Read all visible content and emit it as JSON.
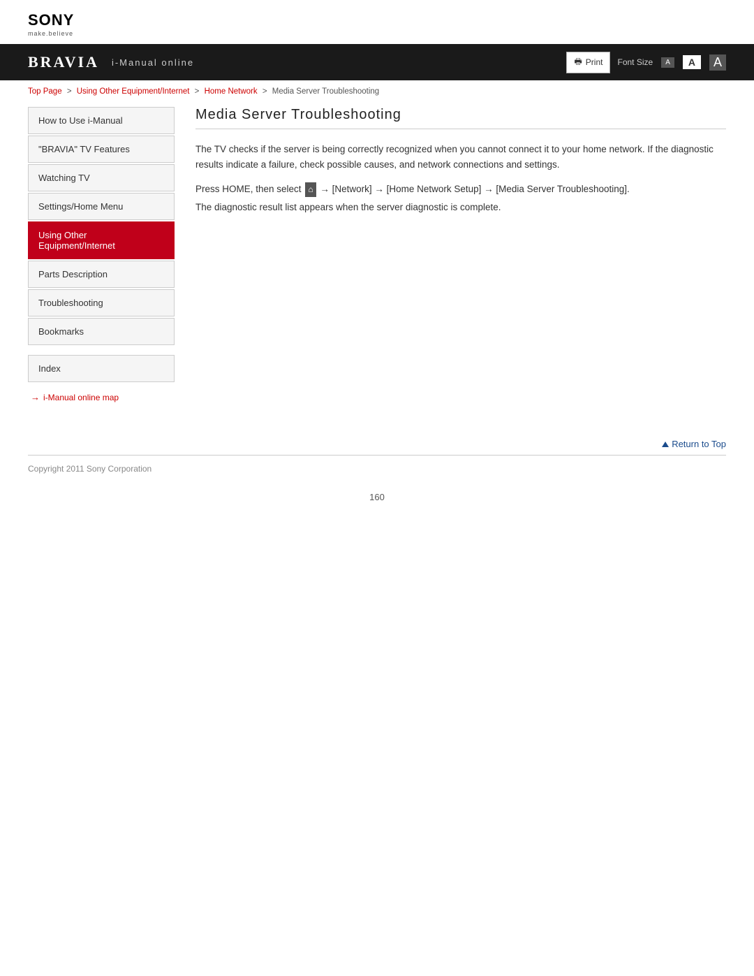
{
  "logo": {
    "brand": "SONY",
    "tagline": "make.believe"
  },
  "header": {
    "bravia": "BRAVIA",
    "imanual": "i-Manual online",
    "print_label": "Print",
    "font_size_label": "Font Size",
    "font_small": "A",
    "font_medium": "A",
    "font_large": "A"
  },
  "breadcrumb": {
    "top_page": "Top Page",
    "sep1": ">",
    "using_other": "Using Other Equipment/Internet",
    "sep2": ">",
    "home_network": "Home Network",
    "sep3": ">",
    "current": "Media Server Troubleshooting"
  },
  "sidebar": {
    "items": [
      {
        "label": "How to Use i-Manual",
        "active": false
      },
      {
        "label": "\"BRAVIA\" TV Features",
        "active": false
      },
      {
        "label": "Watching TV",
        "active": false
      },
      {
        "label": "Settings/Home Menu",
        "active": false
      },
      {
        "label": "Using Other Equipment/Internet",
        "active": true
      },
      {
        "label": "Parts Description",
        "active": false
      },
      {
        "label": "Troubleshooting",
        "active": false
      },
      {
        "label": "Bookmarks",
        "active": false
      }
    ],
    "index_label": "Index",
    "map_link": "i-Manual online map",
    "map_arrow": "→"
  },
  "content": {
    "title": "Media Server Troubleshooting",
    "paragraph1": "The TV checks if the server is being correctly recognized when you cannot connect it to your home network. If the diagnostic results indicate a failure, check possible causes, and network connections and settings.",
    "paragraph2_prefix": "Press HOME, then select ",
    "paragraph2_middle": " → [Network] → [Home Network Setup] → [Media Server Troubleshooting].",
    "paragraph3": "The diagnostic result list appears when the server diagnostic is complete."
  },
  "return_top": "Return to Top",
  "footer": {
    "copyright": "Copyright 2011 Sony Corporation",
    "page_number": "160"
  }
}
